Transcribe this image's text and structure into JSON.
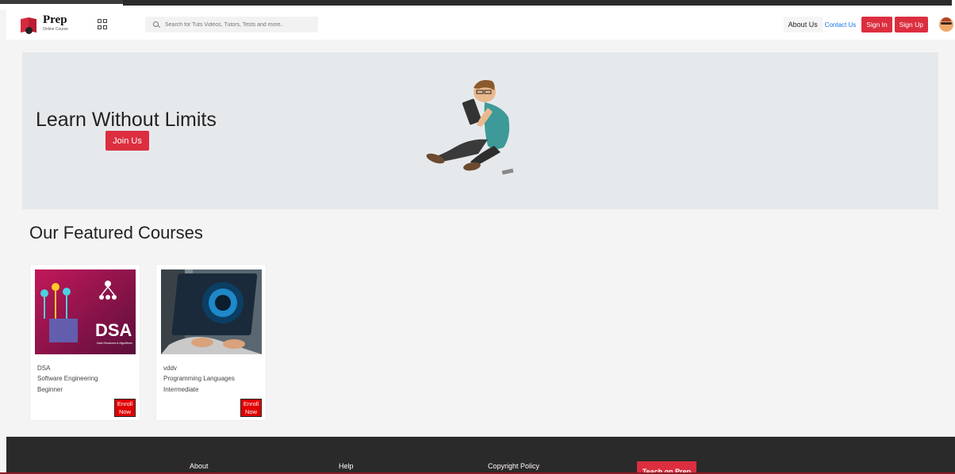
{
  "header": {
    "logo_title": "Prep",
    "logo_subtitle": "Online Course",
    "search_placeholder": "Search for Tuts Videos, Tutors, Tests and more..",
    "about": "About Us",
    "contact": "Contact Us",
    "signin": "Sign In",
    "signup": "Sign Up"
  },
  "hero": {
    "title": "Learn Without Limits",
    "join": "Join Us"
  },
  "featured": {
    "title": "Our Featured Courses",
    "courses": [
      {
        "name": "DSA",
        "category": "Software Engineering",
        "level": "Beginner",
        "enroll": "Enroll Now",
        "thumb_text": "DSA",
        "thumb_sub": "Data Structures & Algorithms"
      },
      {
        "name": "vddv",
        "category": "Programming Languages",
        "level": "Intermediate",
        "enroll": "Enroll Now"
      }
    ]
  },
  "footer": {
    "about": "About",
    "help": "Help",
    "copyright": "Copyright Policy",
    "teach": "Teach on Prep"
  },
  "colors": {
    "accent": "#dc2e3f",
    "link": "#1a73e8",
    "footer_bg": "#2a2a2a",
    "hero_bg": "#e6e9ec"
  }
}
